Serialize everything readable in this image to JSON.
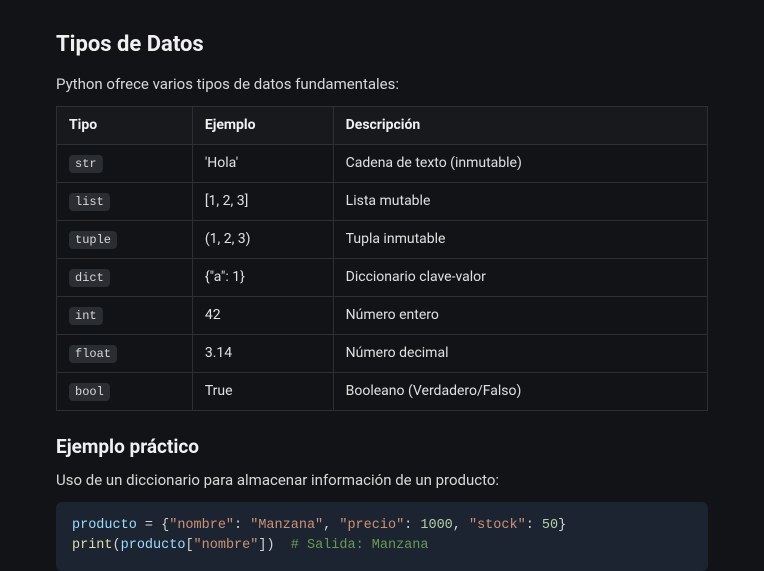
{
  "heading": "Tipos de Datos",
  "intro": "Python ofrece varios tipos de datos fundamentales:",
  "table": {
    "headers": [
      "Tipo",
      "Ejemplo",
      "Descripción"
    ],
    "rows": [
      {
        "type": "str",
        "example": "'Hola'",
        "desc": "Cadena de texto (inmutable)"
      },
      {
        "type": "list",
        "example": "[1, 2, 3]",
        "desc": "Lista mutable"
      },
      {
        "type": "tuple",
        "example": "(1, 2, 3)",
        "desc": "Tupla inmutable"
      },
      {
        "type": "dict",
        "example": "{\"a\": 1}",
        "desc": "Diccionario clave-valor"
      },
      {
        "type": "int",
        "example": "42",
        "desc": "Número entero"
      },
      {
        "type": "float",
        "example": "3.14",
        "desc": "Número decimal"
      },
      {
        "type": "bool",
        "example": "True",
        "desc": "Booleano (Verdadero/Falso)"
      }
    ]
  },
  "example": {
    "heading": "Ejemplo práctico",
    "intro": "Uso de un diccionario para almacenar información de un producto:",
    "code_tokens": [
      [
        {
          "t": "producto",
          "c": "name"
        },
        {
          "t": " = {",
          "c": "op"
        },
        {
          "t": "\"nombre\"",
          "c": "str"
        },
        {
          "t": ": ",
          "c": "op"
        },
        {
          "t": "\"Manzana\"",
          "c": "str"
        },
        {
          "t": ", ",
          "c": "op"
        },
        {
          "t": "\"precio\"",
          "c": "str"
        },
        {
          "t": ": ",
          "c": "op"
        },
        {
          "t": "1000",
          "c": "num"
        },
        {
          "t": ", ",
          "c": "op"
        },
        {
          "t": "\"stock\"",
          "c": "str"
        },
        {
          "t": ": ",
          "c": "op"
        },
        {
          "t": "50",
          "c": "num"
        },
        {
          "t": "}",
          "c": "op"
        }
      ],
      [
        {
          "t": "print",
          "c": "fn"
        },
        {
          "t": "(",
          "c": "op"
        },
        {
          "t": "producto",
          "c": "name"
        },
        {
          "t": "[",
          "c": "op"
        },
        {
          "t": "\"nombre\"",
          "c": "str"
        },
        {
          "t": "])  ",
          "c": "op"
        },
        {
          "t": "# Salida: Manzana",
          "c": "com"
        }
      ]
    ]
  }
}
